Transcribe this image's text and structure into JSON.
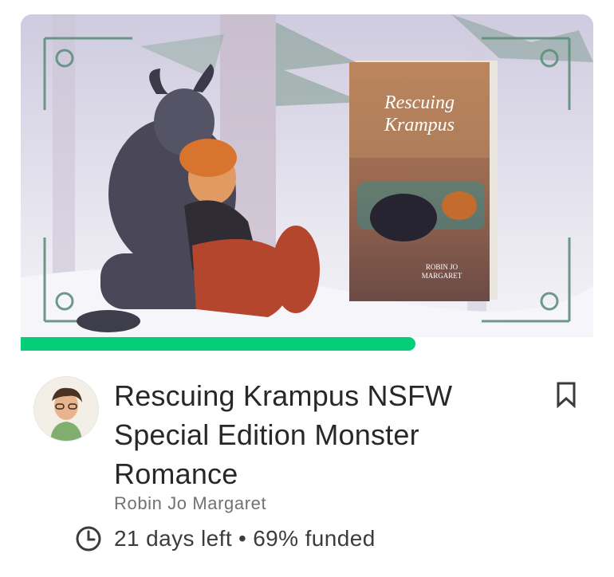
{
  "project": {
    "title": "Rescuing Krampus NSFW Special Edition Monster Romance",
    "creator": "Robin Jo Margaret",
    "days_left": "21 days left",
    "separator": "•",
    "funded": "69% funded",
    "progress_fraction": 0.69,
    "accent_color": "#05ce78"
  },
  "book_cover": {
    "title_line1": "Rescuing",
    "title_line2": "Krampus",
    "author_line1": "ROBIN JO",
    "author_line2": "MARGARET"
  },
  "icons": {
    "bookmark": "bookmark-icon",
    "clock": "clock-icon"
  }
}
